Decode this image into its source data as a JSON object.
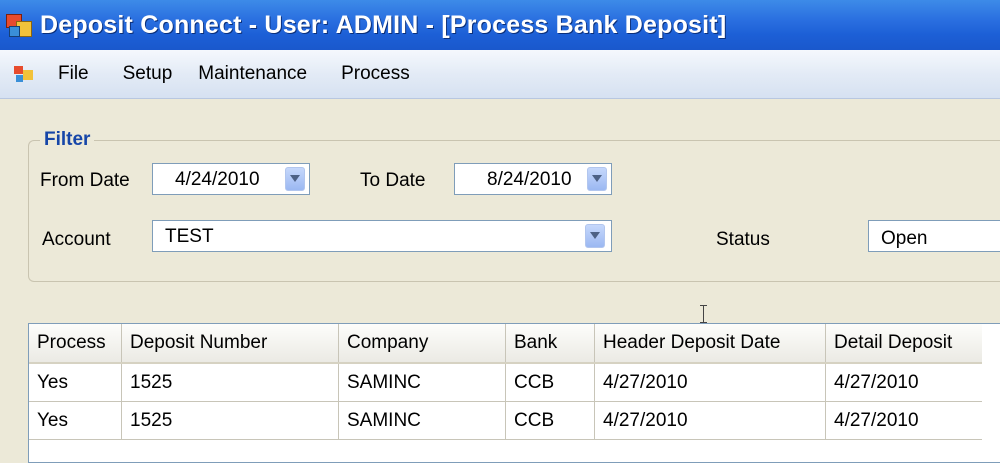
{
  "window": {
    "title": "Deposit Connect - User: ADMIN - [Process Bank Deposit]"
  },
  "menu": {
    "items": [
      "File",
      "Setup",
      "Maintenance",
      "Process"
    ]
  },
  "filter": {
    "legend": "Filter",
    "from_date_label": "From Date",
    "from_date_value": "4/24/2010",
    "to_date_label": "To Date",
    "to_date_value": "8/24/2010",
    "account_label": "Account",
    "account_value": "TEST",
    "status_label": "Status",
    "status_value": "Open"
  },
  "grid": {
    "columns": [
      "Process",
      "Deposit Number",
      "Company",
      "Bank",
      "Header Deposit Date",
      "Detail Deposit"
    ],
    "rows": [
      [
        "Yes",
        "1525",
        "SAMINC",
        "CCB",
        "4/27/2010",
        "4/27/2010"
      ],
      [
        "Yes",
        "1525",
        "SAMINC",
        "CCB",
        "4/27/2010",
        "4/27/2010"
      ]
    ]
  },
  "icons": {
    "app": "app-logo-icon",
    "menu": "mdi-child-icon",
    "dropdown": "chevron-down-icon",
    "cursor": "text-cursor-icon"
  }
}
